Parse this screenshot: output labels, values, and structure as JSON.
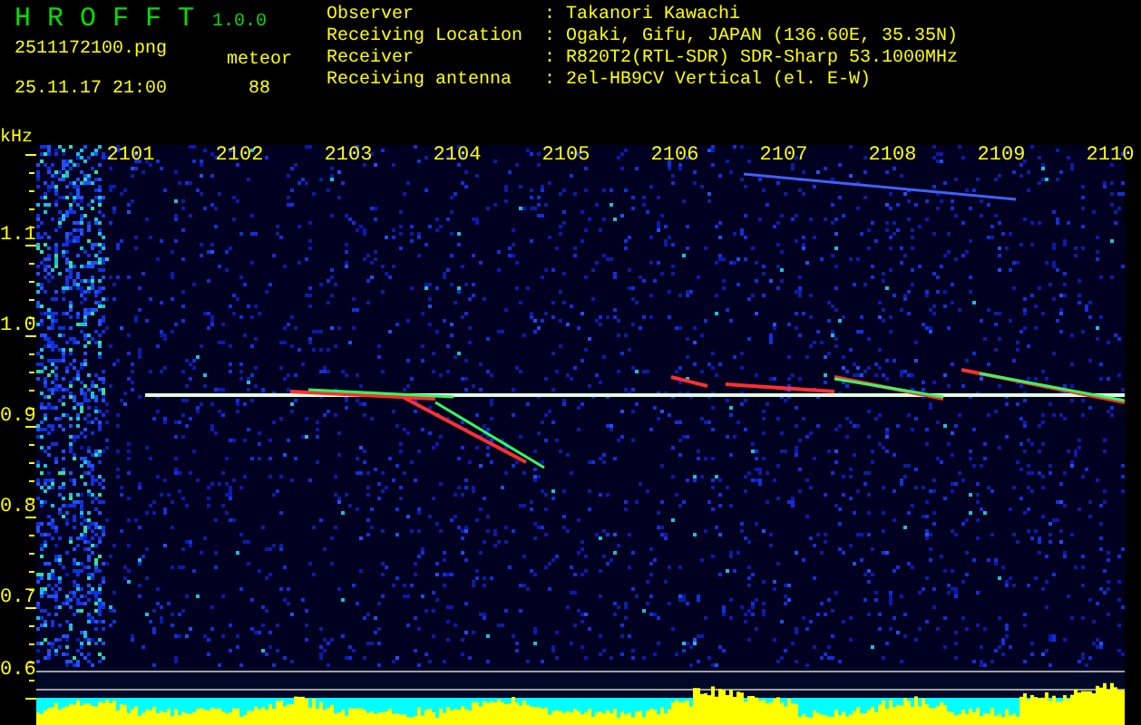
{
  "app": {
    "name": "H R O F F T",
    "version": "1.0.0"
  },
  "file": "2511172100.png",
  "timestamp": "25.11.17 21:00",
  "counter": {
    "label": "meteor",
    "value": "88"
  },
  "info": [
    {
      "label": "Observer",
      "value": ": Takanori Kawachi"
    },
    {
      "label": "Receiving Location",
      "value": ": Ogaki, Gifu, JAPAN (136.60E, 35.35N)"
    },
    {
      "label": "Receiver",
      "value": ": R820T2(RTL-SDR) SDR-Sharp 53.1000MHz"
    },
    {
      "label": "Receiving antenna",
      "value": ": 2el-HB9CV Vertical (el. E-W)"
    }
  ],
  "plot": {
    "unit": "kHz",
    "x_labels": [
      "2101",
      "2102",
      "2103",
      "2104",
      "2105",
      "2106",
      "2107",
      "2108",
      "2109",
      "2110"
    ],
    "y_labels": [
      "1.1",
      "1.0",
      "0.9",
      "0.8",
      "0.7",
      "0.6"
    ]
  }
}
